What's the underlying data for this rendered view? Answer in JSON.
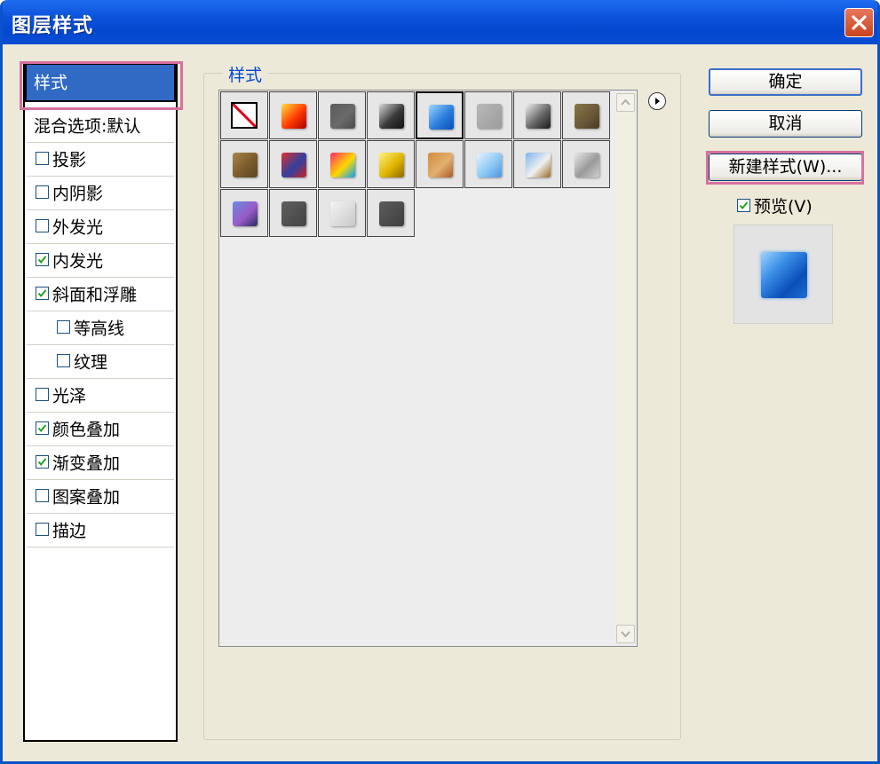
{
  "window": {
    "title": "图层样式"
  },
  "left_panel": {
    "items": [
      {
        "label": "样式",
        "selected": true,
        "checkbox": false
      },
      {
        "label": "混合选项:默认",
        "checkbox": false
      },
      {
        "label": "投影",
        "checkbox": true,
        "checked": false
      },
      {
        "label": "内阴影",
        "checkbox": true,
        "checked": false
      },
      {
        "label": "外发光",
        "checkbox": true,
        "checked": false
      },
      {
        "label": "内发光",
        "checkbox": true,
        "checked": true
      },
      {
        "label": "斜面和浮雕",
        "checkbox": true,
        "checked": true
      },
      {
        "label": "等高线",
        "checkbox": true,
        "checked": false,
        "indented": true
      },
      {
        "label": "纹理",
        "checkbox": true,
        "checked": false,
        "indented": true
      },
      {
        "label": "光泽",
        "checkbox": true,
        "checked": false
      },
      {
        "label": "颜色叠加",
        "checkbox": true,
        "checked": true
      },
      {
        "label": "渐变叠加",
        "checkbox": true,
        "checked": true
      },
      {
        "label": "图案叠加",
        "checkbox": true,
        "checked": false
      },
      {
        "label": "描边",
        "checkbox": true,
        "checked": false
      }
    ]
  },
  "styles_group": {
    "title": "样式",
    "swatches": [
      {
        "icon": "none-style-icon"
      },
      {
        "icon": "red-glow-style-icon",
        "colors": [
          "#ffdf40",
          "#ff3a00",
          "#a80000"
        ]
      },
      {
        "icon": "gray-frame-style-icon",
        "colors": [
          "#5a5a5a",
          "#6a6a6a",
          "#4a4a4a"
        ]
      },
      {
        "icon": "dark-ring-style-icon",
        "colors": [
          "#d8d8d8",
          "#3a3a3a",
          "#111111"
        ]
      },
      {
        "icon": "blue-glass-style-icon",
        "colors": [
          "#9fd4ff",
          "#2a7ddc",
          "#0a4eb8"
        ],
        "selected": true
      },
      {
        "icon": "light-gray-style-icon",
        "colors": [
          "#b8b8b8",
          "#a8a8a8",
          "#9c9c9c"
        ]
      },
      {
        "icon": "chrome-gradient-style-icon",
        "colors": [
          "#f0f0f0",
          "#666666",
          "#1a1a1a"
        ]
      },
      {
        "icon": "bronze-style-icon",
        "colors": [
          "#8a7648",
          "#6a5838",
          "#4a3a20"
        ]
      },
      {
        "icon": "wood-style-icon",
        "colors": [
          "#a8864a",
          "#7a5c2c",
          "#5a4420"
        ]
      },
      {
        "icon": "red-stripes-style-icon",
        "colors": [
          "#e03030",
          "#3040a0",
          "#d02020"
        ]
      },
      {
        "icon": "multicolor-style-icon",
        "colors": [
          "#ff2a6a",
          "#ffd800",
          "#00a0ff"
        ]
      },
      {
        "icon": "gold-style-icon",
        "colors": [
          "#fff27a",
          "#e0b400",
          "#8a6a00"
        ]
      },
      {
        "icon": "sunset-style-icon",
        "colors": [
          "#d68a3a",
          "#e0b070",
          "#b05a20"
        ]
      },
      {
        "icon": "sky-blue-style-icon",
        "colors": [
          "#e6f4ff",
          "#8cc8f4",
          "#4a98e0"
        ]
      },
      {
        "icon": "landscape-style-icon",
        "colors": [
          "#7ab4ee",
          "#f0f0f0",
          "#9a6a20"
        ]
      },
      {
        "icon": "white-noise-style-icon",
        "colors": [
          "#e8e8e8",
          "#9a9a9a",
          "#d0d0d0"
        ]
      },
      {
        "icon": "purple-shadow-style-icon",
        "colors": [
          "#6a8ae0",
          "#9a5ac8",
          "#2a2a60"
        ]
      },
      {
        "icon": "dark-square-style-icon",
        "colors": [
          "#606060",
          "#505050",
          "#444444"
        ]
      },
      {
        "icon": "light-square-style-icon",
        "colors": [
          "#f4f4f4",
          "#dcdcdc",
          "#c8c8c8"
        ]
      },
      {
        "icon": "charcoal-style-icon",
        "colors": [
          "#5c5c5c",
          "#4c4c4c",
          "#3e3e3e"
        ]
      }
    ]
  },
  "buttons": {
    "ok": "确定",
    "cancel": "取消",
    "new_style": "新建样式(W)..."
  },
  "preview": {
    "label": "预览(V)",
    "checked": true
  }
}
